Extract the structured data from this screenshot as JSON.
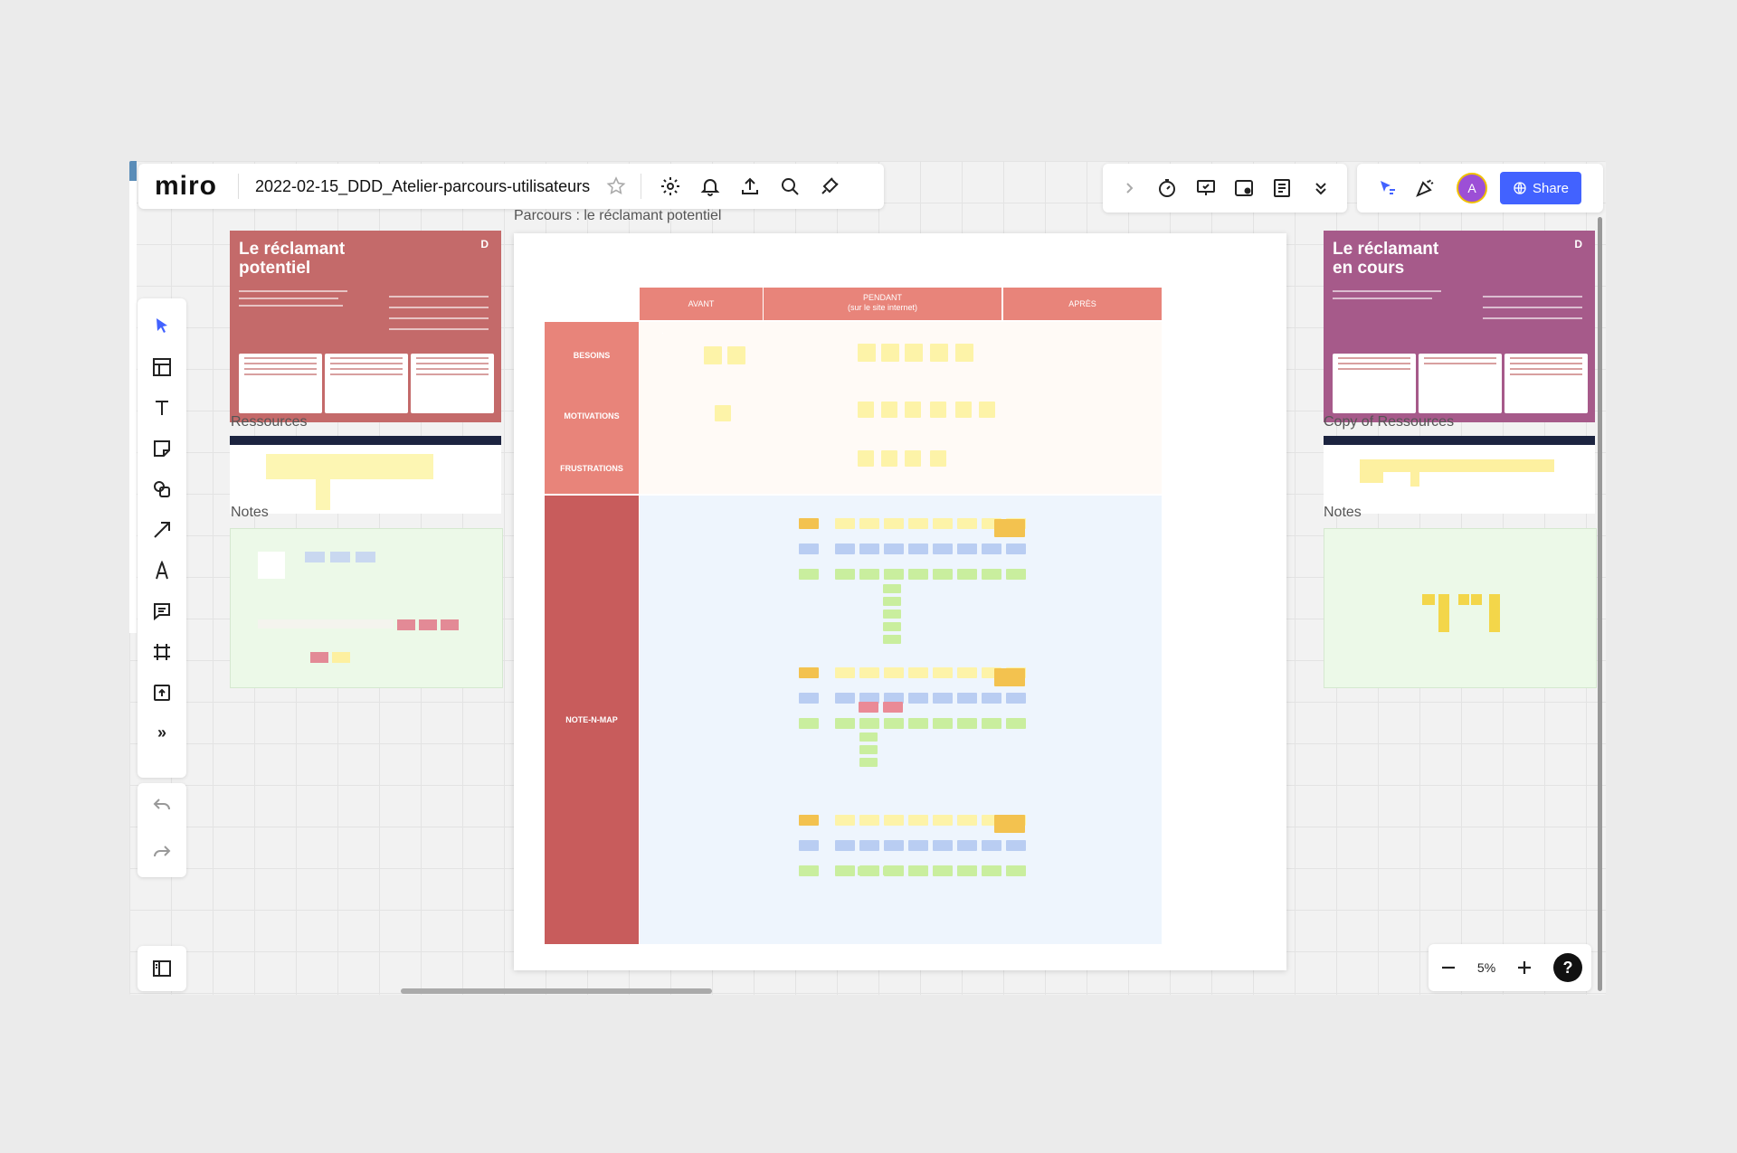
{
  "app": {
    "logo": "miro",
    "board_title": "2022-02-15_DDD_Atelier-parcours-utilisateurs",
    "share_label": "Share",
    "avatar_initial": "A",
    "zoom_level": "5%",
    "help_label": "?"
  },
  "colors": {
    "accent": "#4262ff",
    "persona_red": "#c46a6a",
    "persona_purple": "#a65a8a",
    "grid_header": "#e8847a",
    "grid_row": "#c85c5c",
    "note_map_bg": "#eef5fd",
    "notes_bg": "#ecf9e8"
  },
  "toolbar_icons": [
    "settings-icon",
    "bell-icon",
    "upload-icon",
    "search-icon",
    "plugin-icon"
  ],
  "right_tool_icons": [
    "chevron-right-icon",
    "timer-icon",
    "present-icon",
    "screen-share-icon",
    "notes-icon",
    "chevron-down-icon"
  ],
  "collab_icons": [
    "cursor-icon",
    "reactions-icon"
  ],
  "left_tools": [
    "select-icon",
    "templates-icon",
    "text-icon",
    "sticky-note-icon",
    "shapes-icon",
    "arrow-icon",
    "pen-icon",
    "comment-icon",
    "frame-icon",
    "upload-tool-icon",
    "more-tools-icon"
  ],
  "canvas": {
    "frame_left_resources": "Ressources",
    "frame_left_notes": "Notes",
    "frame_right_resources": "Copy of Ressources",
    "frame_right_notes": "Notes",
    "main_frame_title": "Parcours : le réclamant potentiel",
    "persona_left_title": "Le réclamant potentiel",
    "persona_right_title": "Le réclamant en cours",
    "persona_left_logo": "D",
    "persona_right_logo": "D",
    "columns": [
      {
        "label": "AVANT",
        "sub": ""
      },
      {
        "label": "PENDANT",
        "sub": "(sur le site internet)"
      },
      {
        "label": "APRÈS",
        "sub": ""
      }
    ],
    "rows": [
      "BESOINS",
      "MOTIVATIONS",
      "FRUSTRATIONS",
      "NOTE-N-MAP"
    ]
  }
}
